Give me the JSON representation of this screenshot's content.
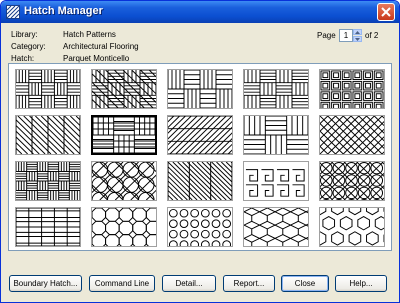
{
  "window": {
    "title": "Hatch Manager"
  },
  "info": {
    "library_label": "Library:",
    "library_value": "Hatch Patterns",
    "category_label": "Category:",
    "category_value": "Architectural Flooring",
    "hatch_label": "Hatch:",
    "hatch_value": "Parquet Monticello"
  },
  "pager": {
    "label": "Page",
    "current": "1",
    "of_text": "of 2"
  },
  "patterns": {
    "selected_index": 6,
    "count": 20,
    "tile_names": [
      "basketweave-tile",
      "herringbone-diagonal-tile",
      "parquet-squares-tile",
      "parquet-blocks-tile",
      "concentric-squares-tile",
      "diagonal-weave-tile",
      "plank-blocks-tile",
      "herringbone-tile",
      "staggered-plank-tile",
      "diamond-weave-tile",
      "small-blocks-tile",
      "parquet-monticello-tile",
      "diagonal-parquet-tile",
      "greek-key-tile",
      "circle-lattice-tile",
      "grid-tile",
      "octagon-tile",
      "circle-rows-tile",
      "cube-lattice-tile",
      "hexagon-tile"
    ]
  },
  "buttons": {
    "boundary_hatch": "Boundary Hatch...",
    "command_line": "Command Line",
    "detail": "Detail...",
    "report": "Report...",
    "close": "Close",
    "help": "Help..."
  },
  "colors": {
    "title_bar": "#0b4fd1",
    "dialog_bg": "#ece9d8",
    "button_border": "#003c74"
  }
}
